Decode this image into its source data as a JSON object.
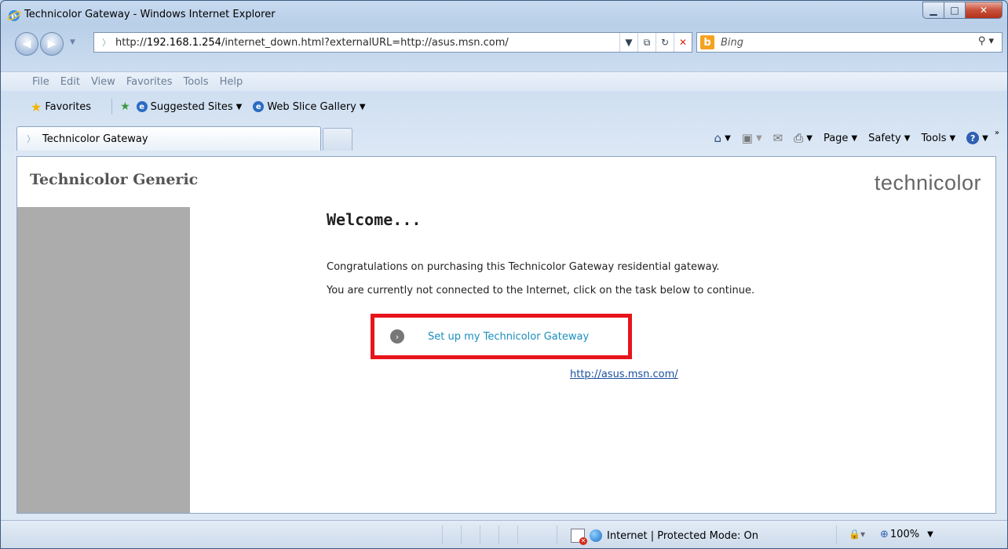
{
  "window": {
    "title": "Technicolor Gateway - Windows Internet Explorer"
  },
  "address_bar": {
    "url_prefix": "http://",
    "url_host": "192.168.1.254",
    "url_rest": "/internet_down.html?externalURL=http://asus.msn.com/"
  },
  "search": {
    "provider": "Bing"
  },
  "menu": [
    "File",
    "Edit",
    "View",
    "Favorites",
    "Tools",
    "Help"
  ],
  "favorites_bar": {
    "favorites_label": "Favorites",
    "links": [
      "Suggested Sites",
      "Web Slice Gallery"
    ]
  },
  "tab": {
    "title": "Technicolor Gateway"
  },
  "command_bar": {
    "page": "Page",
    "safety": "Safety",
    "tools": "Tools"
  },
  "page": {
    "brand_title": "Technicolor Generic",
    "brand_logo": "technicolor",
    "welcome": "Welcome...",
    "line1": "Congratulations on purchasing this Technicolor Gateway residential gateway.",
    "line2": "You are currently not connected to the Internet, click on the task below to continue.",
    "setup_label": "Set up my Technicolor Gateway",
    "external_url": "http://asus.msn.com/"
  },
  "status_bar": {
    "zone": "Internet | Protected Mode: On",
    "zoom": "100%"
  },
  "colors": {
    "highlight_border": "#e8141c",
    "link": "#1a8fbf",
    "sidebar": "#acacac"
  }
}
